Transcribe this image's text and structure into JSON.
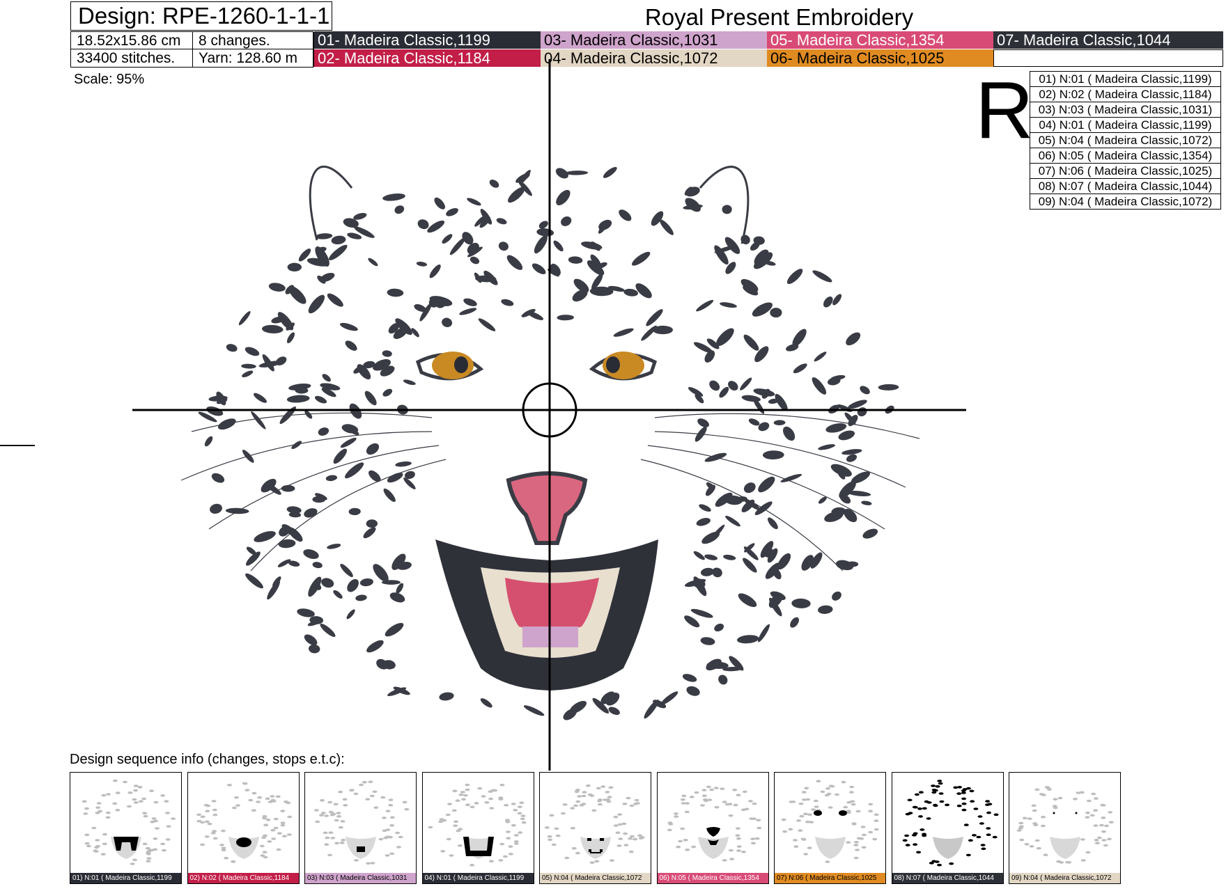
{
  "header": {
    "design_label": "Design: RPE-1260-1-1-1",
    "brand": "Royal Present Embroidery"
  },
  "info": {
    "size": "18.52x15.86 cm",
    "changes": "8 changes.",
    "stitches": "33400 stitches.",
    "yarn": "Yarn: 128.60 m"
  },
  "threads": [
    {
      "label": "01- Madeira Classic,1199",
      "color": "#2a2c35",
      "text_color": "#ffffff"
    },
    {
      "label": "02- Madeira Classic,1184",
      "color": "#c21e48",
      "text_color": "#ffffff"
    },
    {
      "label": "03- Madeira Classic,1031",
      "color": "#cfa4cc",
      "text_color": "#000000"
    },
    {
      "label": "04- Madeira Classic,1072",
      "color": "#e2d6c4",
      "text_color": "#000000"
    },
    {
      "label": "05- Madeira Classic,1354",
      "color": "#d94b77",
      "text_color": "#ffffff"
    },
    {
      "label": "06- Madeira Classic,1025",
      "color": "#e08b22",
      "text_color": "#000000"
    },
    {
      "label": "07- Madeira Classic,1044",
      "color": "#2e3038",
      "text_color": "#ffffff"
    }
  ],
  "scale": "Scale: 95%",
  "big_letter": "R",
  "sequence_list": [
    "01) N:01 ( Madeira Classic,1199)",
    "02) N:02 ( Madeira Classic,1184)",
    "03) N:03 ( Madeira Classic,1031)",
    "04) N:01 ( Madeira Classic,1199)",
    "05) N:04 ( Madeira Classic,1072)",
    "06) N:05 ( Madeira Classic,1354)",
    "07) N:06 ( Madeira Classic,1025)",
    "08) N:07 ( Madeira Classic,1044)",
    "09) N:04 ( Madeira Classic,1072)"
  ],
  "sequence_title": "Design sequence info (changes, stops e.t.c):",
  "thumbnails": [
    {
      "label": "01) N:01 ( Madeira Classic,1199",
      "color": "#2a2c35",
      "text_color": "#ffffff",
      "highlight": "fangs-outline"
    },
    {
      "label": "02) N:02 ( Madeira Classic,1184",
      "color": "#c21e48",
      "text_color": "#ffffff",
      "highlight": "tongue"
    },
    {
      "label": "03) N:03 ( Madeira Classic,1031",
      "color": "#cfa4cc",
      "text_color": "#000000",
      "highlight": "lower-tongue"
    },
    {
      "label": "04) N:01 ( Madeira Classic,1199",
      "color": "#2a2c35",
      "text_color": "#ffffff",
      "highlight": "mouth-outline"
    },
    {
      "label": "05) N:04 ( Madeira Classic,1072",
      "color": "#e2d6c4",
      "text_color": "#000000",
      "highlight": "teeth"
    },
    {
      "label": "06) N:05 ( Madeira Classic,1354",
      "color": "#d94b77",
      "text_color": "#ffffff",
      "highlight": "nose"
    },
    {
      "label": "07) N:06 ( Madeira Classic,1025",
      "color": "#e08b22",
      "text_color": "#000000",
      "highlight": "eyes"
    },
    {
      "label": "08) N:07 ( Madeira Classic,1044",
      "color": "#2e3038",
      "text_color": "#ffffff",
      "highlight": "spots"
    },
    {
      "label": "09) N:04 ( Madeira Classic,1072",
      "color": "#e2d6c4",
      "text_color": "#000000",
      "highlight": "eye-dots"
    }
  ],
  "artwork": {
    "subject": "snarling snow leopard head embroidery",
    "spot_color": "#3a3c45",
    "eye_color": "#c98a24",
    "nose_color": "#d9677f",
    "tongue_color": "#d5506e",
    "teeth_color": "#e8dfcf",
    "mouth_color": "#2f3139"
  }
}
